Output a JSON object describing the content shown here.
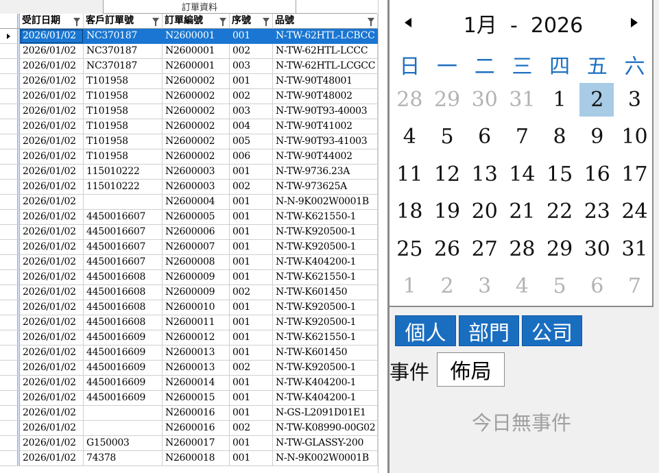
{
  "grid": {
    "tab_title": "訂單資料",
    "columns": [
      "受訂日期",
      "客戶訂單號",
      "訂單編號",
      "序號",
      "品號"
    ],
    "rows": [
      [
        "2026/01/02",
        "NC370187",
        "N2600001",
        "001",
        "N-TW-62HTL-LCBCC"
      ],
      [
        "2026/01/02",
        "NC370187",
        "N2600001",
        "002",
        "N-TW-62HTL-LCCC"
      ],
      [
        "2026/01/02",
        "NC370187",
        "N2600001",
        "003",
        "N-TW-62HTL-LCGCC"
      ],
      [
        "2026/01/02",
        "T101958",
        "N2600002",
        "001",
        "N-TW-90T48001"
      ],
      [
        "2026/01/02",
        "T101958",
        "N2600002",
        "002",
        "N-TW-90T48002"
      ],
      [
        "2026/01/02",
        "T101958",
        "N2600002",
        "003",
        "N-TW-90T93-40003"
      ],
      [
        "2026/01/02",
        "T101958",
        "N2600002",
        "004",
        "N-TW-90T41002"
      ],
      [
        "2026/01/02",
        "T101958",
        "N2600002",
        "005",
        "N-TW-90T93-41003"
      ],
      [
        "2026/01/02",
        "T101958",
        "N2600002",
        "006",
        "N-TW-90T44002"
      ],
      [
        "2026/01/02",
        "115010222",
        "N2600003",
        "001",
        "N-TW-9736.23A"
      ],
      [
        "2026/01/02",
        "115010222",
        "N2600003",
        "002",
        "N-TW-973625A"
      ],
      [
        "2026/01/02",
        "",
        "N2600004",
        "001",
        "N-N-9K002W0001B"
      ],
      [
        "2026/01/02",
        "4450016607",
        "N2600005",
        "001",
        "N-TW-K621550-1"
      ],
      [
        "2026/01/02",
        "4450016607",
        "N2600006",
        "001",
        "N-TW-K920500-1"
      ],
      [
        "2026/01/02",
        "4450016607",
        "N2600007",
        "001",
        "N-TW-K920500-1"
      ],
      [
        "2026/01/02",
        "4450016607",
        "N2600008",
        "001",
        "N-TW-K404200-1"
      ],
      [
        "2026/01/02",
        "4450016608",
        "N2600009",
        "001",
        "N-TW-K621550-1"
      ],
      [
        "2026/01/02",
        "4450016608",
        "N2600009",
        "002",
        "N-TW-K601450"
      ],
      [
        "2026/01/02",
        "4450016608",
        "N2600010",
        "001",
        "N-TW-K920500-1"
      ],
      [
        "2026/01/02",
        "4450016608",
        "N2600011",
        "001",
        "N-TW-K920500-1"
      ],
      [
        "2026/01/02",
        "4450016609",
        "N2600012",
        "001",
        "N-TW-K621550-1"
      ],
      [
        "2026/01/02",
        "4450016609",
        "N2600013",
        "001",
        "N-TW-K601450"
      ],
      [
        "2026/01/02",
        "4450016609",
        "N2600013",
        "002",
        "N-TW-K920500-1"
      ],
      [
        "2026/01/02",
        "4450016609",
        "N2600014",
        "001",
        "N-TW-K404200-1"
      ],
      [
        "2026/01/02",
        "4450016609",
        "N2600015",
        "001",
        "N-TW-K404200-1"
      ],
      [
        "2026/01/02",
        "",
        "N2600016",
        "001",
        "N-GS-L2091D01E1"
      ],
      [
        "2026/01/02",
        "",
        "N2600016",
        "002",
        "N-TW-K08990-00G02"
      ],
      [
        "2026/01/02",
        "G150003",
        "N2600017",
        "001",
        "N-TW-GLASSY-200"
      ],
      [
        "2026/01/02",
        "74378",
        "N2600018",
        "001",
        "N-N-9K002W0001B"
      ]
    ]
  },
  "calendar": {
    "month_label": "1月",
    "separator": "-",
    "year": "2026",
    "weekdays": [
      "日",
      "一",
      "二",
      "三",
      "四",
      "五",
      "六"
    ],
    "weeks": [
      [
        "28",
        "29",
        "30",
        "31",
        "1",
        "2",
        "3"
      ],
      [
        "4",
        "5",
        "6",
        "7",
        "8",
        "9",
        "10"
      ],
      [
        "11",
        "12",
        "13",
        "14",
        "15",
        "16",
        "17"
      ],
      [
        "18",
        "19",
        "20",
        "21",
        "22",
        "23",
        "24"
      ],
      [
        "25",
        "26",
        "27",
        "28",
        "29",
        "30",
        "31"
      ],
      [
        "1",
        "2",
        "3",
        "4",
        "5",
        "6",
        "7"
      ]
    ],
    "selected_day": "2"
  },
  "events": {
    "scope_buttons": [
      "個人",
      "部門",
      "公司"
    ],
    "event_label": "事件",
    "event_button": "佈局",
    "empty_message": "今日無事件"
  }
}
